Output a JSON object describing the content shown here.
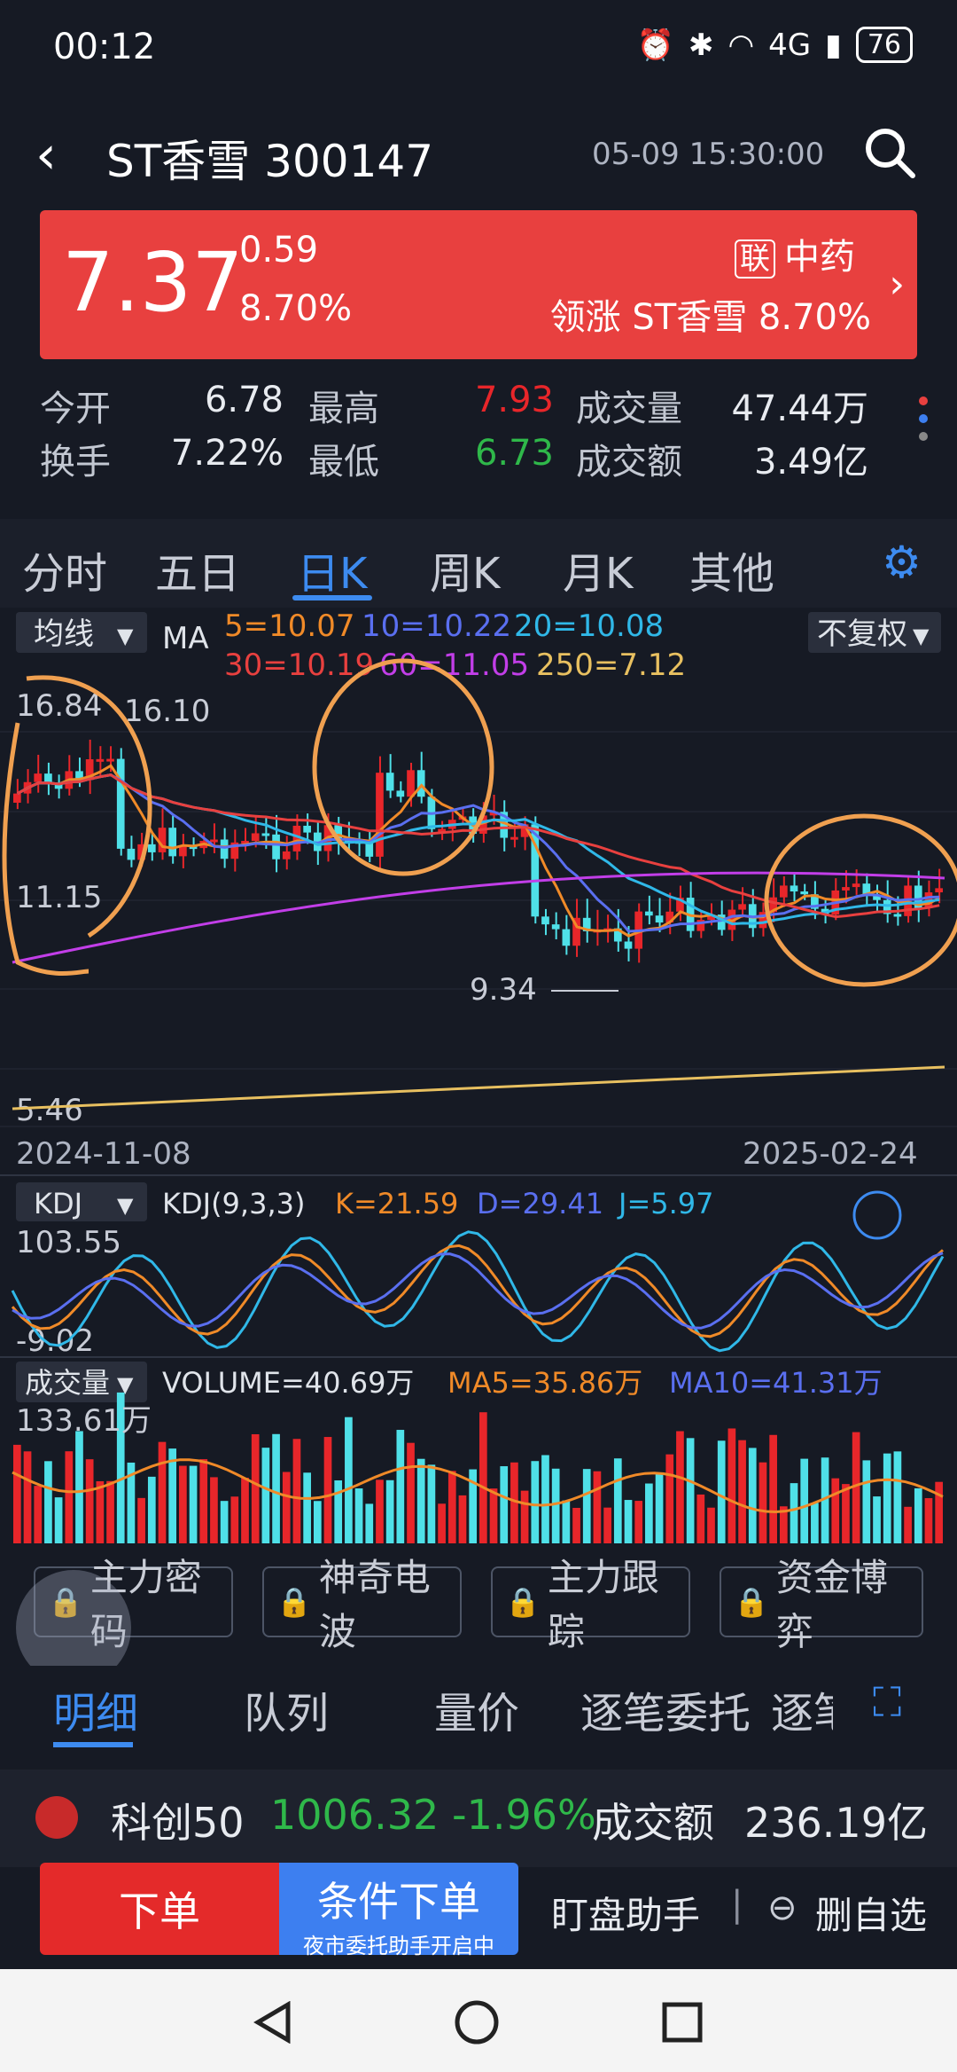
{
  "status": {
    "time": "00:12",
    "battery": "76",
    "net": "4G"
  },
  "header": {
    "title": "ST香雪 300147",
    "datetime": "05-09 15:30:00"
  },
  "price": {
    "last": "7.37",
    "change": "0.59",
    "pct": "8.70%",
    "tag": "联",
    "sector": "中药",
    "lead_label": "领涨",
    "lead_name": "ST香雪",
    "lead_pct": "8.70%"
  },
  "stats": {
    "open_l": "今开",
    "open": "6.78",
    "high_l": "最高",
    "high": "7.93",
    "vol_l": "成交量",
    "vol": "47.44万",
    "turn_l": "换手",
    "turn": "7.22%",
    "low_l": "最低",
    "low": "6.73",
    "amt_l": "成交额",
    "amt": "3.49亿"
  },
  "tabs": [
    "分时",
    "五日",
    "日K",
    "周K",
    "月K",
    "其他"
  ],
  "chart": {
    "ma_select": "均线",
    "ma_label": "MA",
    "adj": "不复权",
    "ma5": "5=10.07",
    "ma10": "10=10.22",
    "ma20": "20=10.08",
    "ma30": "30=10.19",
    "ma60": "60=11.05",
    "ma250": "250=7.12",
    "high_lbl": "16.84",
    "high2": "16.10",
    "mid_lbl": "11.15",
    "low_lbl": "9.34",
    "bottom_lbl": "5.46",
    "date_start": "2024-11-08",
    "date_end": "2025-02-24",
    "kdj_select": "KDJ",
    "kdj_label": "KDJ(9,3,3)",
    "k": "K=21.59",
    "d": "D=29.41",
    "j": "J=5.97",
    "kdj_top": "103.55",
    "kdj_bot": "-9.02",
    "vol_select": "成交量",
    "vol_label": "VOLUME=40.69万",
    "vma5": "MA5=35.86万",
    "vma10": "MA10=41.31万",
    "vol_top": "133.61万",
    "colors": {
      "up": "#e8262a",
      "down": "#4fe0e8",
      "ma5": "#f08a28",
      "ma10": "#5a6ff0",
      "ma20": "#30b8e8",
      "ma30": "#e8403f",
      "ma60": "#c23ee8",
      "ma250": "#e8c060",
      "circle": "#f0a050"
    }
  },
  "features": [
    "主力密码",
    "神奇电波",
    "主力跟踪",
    "资金博弈"
  ],
  "subtabs": [
    "明细",
    "队列",
    "量价",
    "逐笔委托",
    "逐笔"
  ],
  "ticker": {
    "name": "科创50",
    "value": "1006.32",
    "pct": "-1.96%",
    "amt_l": "成交额",
    "amt": "236.19亿"
  },
  "bottom": {
    "order": "下单",
    "cond": "条件下单",
    "cond_sub": "夜市委托助手开启中",
    "assist": "盯盘助手",
    "remove": "删自选"
  }
}
